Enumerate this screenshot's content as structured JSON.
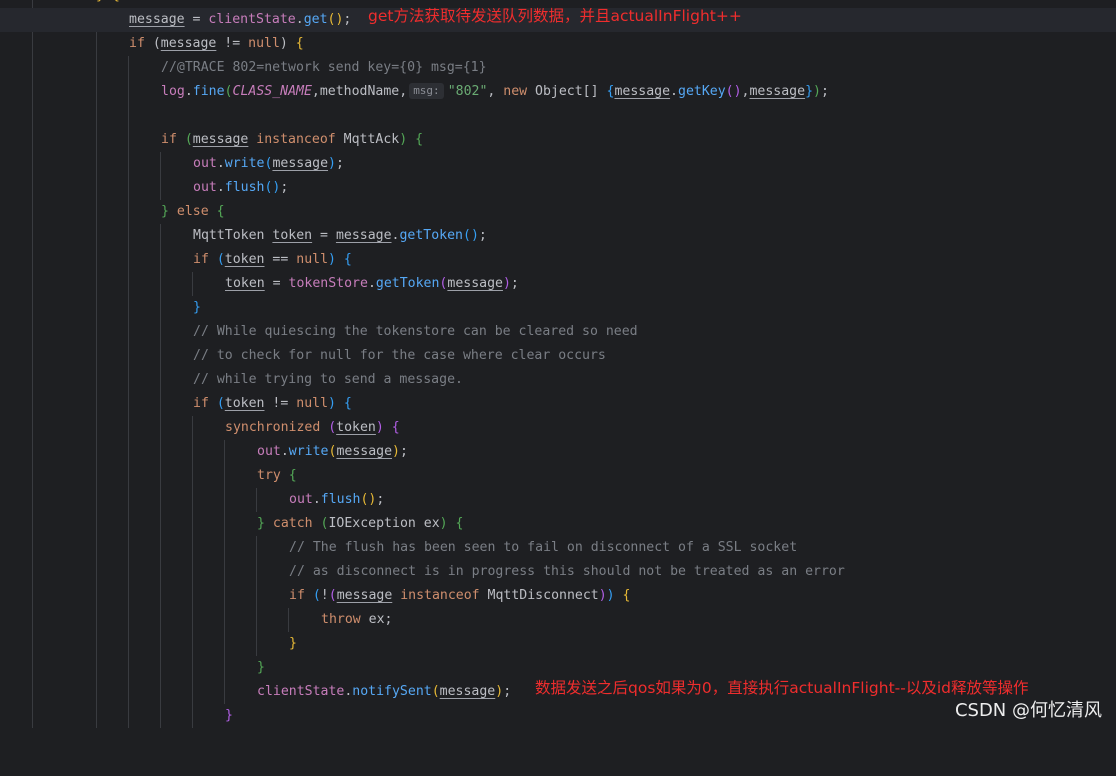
{
  "code": {
    "l0": {
      "tail": "} {"
    },
    "l1": {
      "message": "message",
      "eq": " = ",
      "clientState": "clientState",
      "dot": ".",
      "get": "get",
      "paren": "()",
      "semi": ";"
    },
    "l2": {
      "if": "if",
      "open": " (",
      "message": "message",
      "ne": " != ",
      "null": "null",
      "close": ") ",
      "brace": "{"
    },
    "l3": {
      "comment": "//@TRACE 802=network send key={0} msg={1}"
    },
    "l4": {
      "log": "log",
      "dot": ".",
      "fine": "fine",
      "lp": "(",
      "className": "CLASS_NAME",
      "comma1": ",methodName,",
      "hint": "msg:",
      "str": "\"802\"",
      "comma2": ", ",
      "new": "new",
      "obj": " Object[] ",
      "lb": "{",
      "message1": "message",
      "dot2": ".",
      "getKey": "getKey",
      "paren": "()",
      "comma3": ",",
      "message2": "message",
      "rb": "}",
      "rp": ")",
      "semi": ";"
    },
    "l6": {
      "if": "if",
      "lp": " (",
      "message": "message",
      "instanceof": " instanceof",
      "type": " MqttAck",
      "rp": ")",
      "brace": " {"
    },
    "l7": {
      "out": "out",
      "dot": ".",
      "write": "write",
      "lp": "(",
      "message": "message",
      "rp": ")",
      "semi": ";"
    },
    "l8": {
      "out": "out",
      "dot": ".",
      "flush": "flush",
      "paren": "()",
      "semi": ";"
    },
    "l9": {
      "rb": "}",
      "else": " else",
      "lb": " {"
    },
    "l10": {
      "type": "MqttToken ",
      "token": "token",
      "eq": " = ",
      "message": "message",
      "dot": ".",
      "getToken": "getToken",
      "paren": "()",
      "semi": ";"
    },
    "l11": {
      "if": "if",
      "lp": " (",
      "token": "token",
      "eq": " == ",
      "null": "null",
      "rp": ")",
      "brace": " {"
    },
    "l12": {
      "token": "token",
      "eq": " = ",
      "tokenStore": "tokenStore",
      "dot": ".",
      "getToken": "getToken",
      "lp": "(",
      "message": "message",
      "rp": ")",
      "semi": ";"
    },
    "l13": {
      "rb": "}"
    },
    "l14": {
      "comment": "// While quiescing the tokenstore can be cleared so need"
    },
    "l15": {
      "comment": "// to check for null for the case where clear occurs"
    },
    "l16": {
      "comment": "// while trying to send a message."
    },
    "l17": {
      "if": "if",
      "lp": " (",
      "token": "token",
      "ne": " != ",
      "null": "null",
      "rp": ")",
      "brace": " {"
    },
    "l18": {
      "sync": "synchronized",
      "lp": " (",
      "token": "token",
      "rp": ")",
      "brace": " {"
    },
    "l19": {
      "out": "out",
      "dot": ".",
      "write": "write",
      "lp": "(",
      "message": "message",
      "rp": ")",
      "semi": ";"
    },
    "l20": {
      "try": "try",
      "brace": " {"
    },
    "l21": {
      "out": "out",
      "dot": ".",
      "flush": "flush",
      "paren": "()",
      "semi": ";"
    },
    "l22": {
      "rb": "}",
      "catch": " catch",
      "lp": " (",
      "type": "IOException ex",
      "rp": ")",
      "brace": " {"
    },
    "l23": {
      "comment": "// The flush has been seen to fail on disconnect of a SSL socket"
    },
    "l24": {
      "comment": "// as disconnect is in progress this should not be treated as an error"
    },
    "l25": {
      "if": "if",
      "lp": " (",
      "not": "!",
      "lp2": "(",
      "message": "message",
      "instanceof": " instanceof",
      "type": " MqttDisconnect",
      "rp2": ")",
      "rp": ")",
      "brace": " {"
    },
    "l26": {
      "throw": "throw",
      "ex": " ex",
      "semi": ";"
    },
    "l27": {
      "rb": "}"
    },
    "l28": {
      "rb": "}"
    },
    "l29": {
      "clientState": "clientState",
      "dot": ".",
      "notifySent": "notifySent",
      "lp": "(",
      "message": "message",
      "rp": ")",
      "semi": ";"
    },
    "l30": {
      "rb": "}"
    }
  },
  "annotations": {
    "top": "get方法获取待发送队列数据，并且actualInFlight++",
    "bottom": "数据发送之后qos如果为0，直接执行actualInFlight--以及id释放等操作"
  },
  "watermark": "CSDN @何忆清风",
  "colors": {
    "background": "#1e1f22",
    "annotation": "#ef2d2d",
    "keyword": "#cf8e6d",
    "method": "#56a8f5",
    "comment": "#7a7e85",
    "string": "#6aab73"
  }
}
